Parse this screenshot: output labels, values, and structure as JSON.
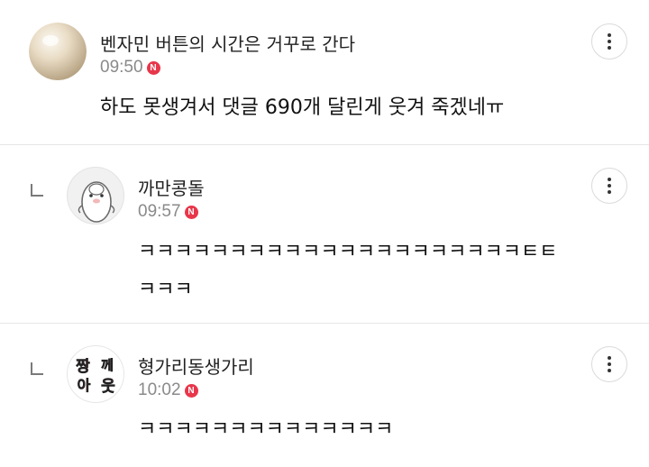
{
  "comments": [
    {
      "nickname": "벤자민 버튼의 시간은 거꾸로 간다",
      "time": "09:50",
      "new_badge": "N",
      "text": "하도 못생겨서 댓글 690개 달린게 웃겨 죽겠네ㅠ",
      "is_reply": false
    },
    {
      "nickname": "까만콩돌",
      "time": "09:57",
      "new_badge": "N",
      "text": "ㅋㅋㅋㅋㅋㅋㅋㅋㅋㅋㅋㅋㅋㅋㅋㅋㅋㅋㅋㅋㅋㅌㅌ\nㅋㅋㅋ",
      "is_reply": true
    },
    {
      "nickname": "형가리동생가리",
      "time": "10:02",
      "new_badge": "N",
      "text": "ㅋㅋㅋㅋㅋㅋㅋㅋㅋㅋㅋㅋㅋㅋ",
      "is_reply": true,
      "avatar_text": [
        "짱",
        "께",
        "아",
        "웃"
      ]
    }
  ],
  "colors": {
    "badge": "#e8364a",
    "time": "#8a8a8a",
    "divider": "#e6e6e6"
  }
}
